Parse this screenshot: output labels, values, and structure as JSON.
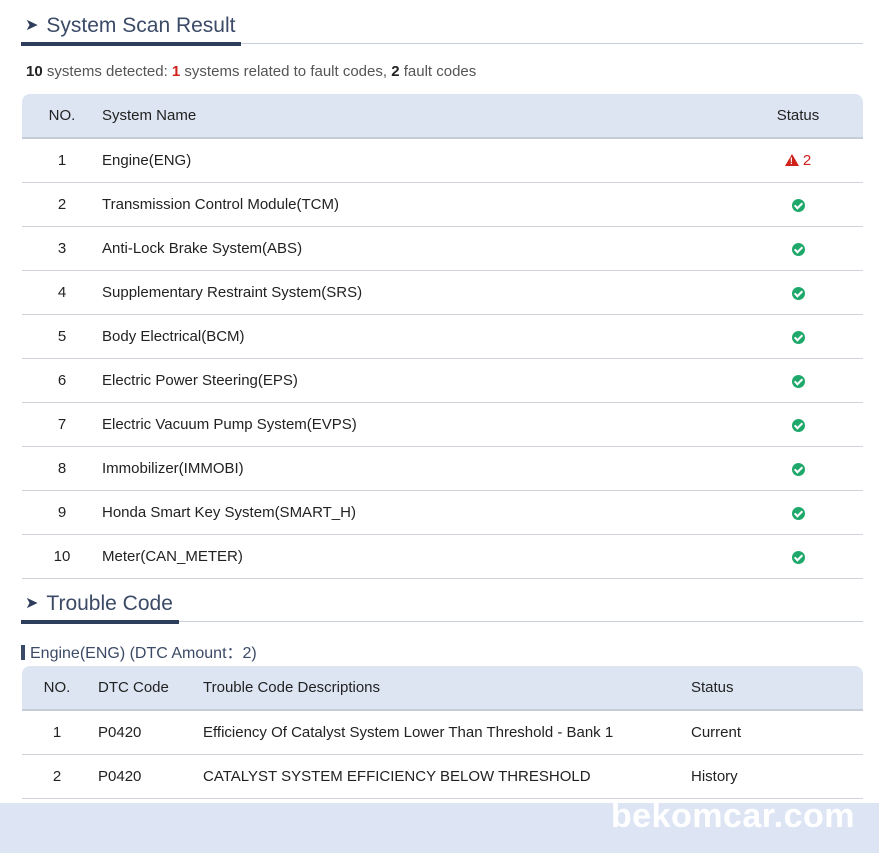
{
  "scan_section": {
    "title": "System Scan Result",
    "summary": {
      "systems_count": "10",
      "systems_text": " systems detected: ",
      "fault_systems_count": "1",
      "fault_systems_text": " systems related to fault codes, ",
      "fault_codes_count": "2",
      "fault_codes_text": " fault codes"
    },
    "columns": {
      "no": "NO.",
      "name": "System Name",
      "status": "Status"
    },
    "rows": [
      {
        "no": "1",
        "name": "Engine(ENG)",
        "status": "fault",
        "fault_count": "2"
      },
      {
        "no": "2",
        "name": "Transmission Control Module(TCM)",
        "status": "ok"
      },
      {
        "no": "3",
        "name": "Anti-Lock Brake System(ABS)",
        "status": "ok"
      },
      {
        "no": "4",
        "name": "Supplementary Restraint System(SRS)",
        "status": "ok"
      },
      {
        "no": "5",
        "name": "Body Electrical(BCM)",
        "status": "ok"
      },
      {
        "no": "6",
        "name": "Electric Power Steering(EPS)",
        "status": "ok"
      },
      {
        "no": "7",
        "name": "Electric Vacuum Pump System(EVPS)",
        "status": "ok"
      },
      {
        "no": "8",
        "name": "Immobilizer(IMMOBI)",
        "status": "ok"
      },
      {
        "no": "9",
        "name": "Honda Smart Key System(SMART_H)",
        "status": "ok"
      },
      {
        "no": "10",
        "name": "Meter(CAN_METER)",
        "status": "ok"
      }
    ]
  },
  "trouble_section": {
    "title": "Trouble Code",
    "subheading": "Engine(ENG) (DTC Amount：2)",
    "columns": {
      "no": "NO.",
      "code": "DTC Code",
      "desc": "Trouble Code Descriptions",
      "status": "Status"
    },
    "rows": [
      {
        "no": "1",
        "code": "P0420",
        "desc": "Efficiency Of Catalyst System Lower Than Threshold - Bank 1",
        "status": "Current"
      },
      {
        "no": "2",
        "code": "P0420",
        "desc": "CATALYST SYSTEM EFFICIENCY BELOW THRESHOLD",
        "status": "History"
      }
    ]
  },
  "watermark": "bekomcar.com",
  "colors": {
    "accent": "#2e3d5c",
    "fault_red": "#d0201a",
    "ok_green": "#1ea86a",
    "header_bg": "#dde5f2"
  },
  "icons": {
    "section_arrow": "arrow-right-icon",
    "ok": "check-circle-icon",
    "fault": "warning-triangle-icon"
  }
}
